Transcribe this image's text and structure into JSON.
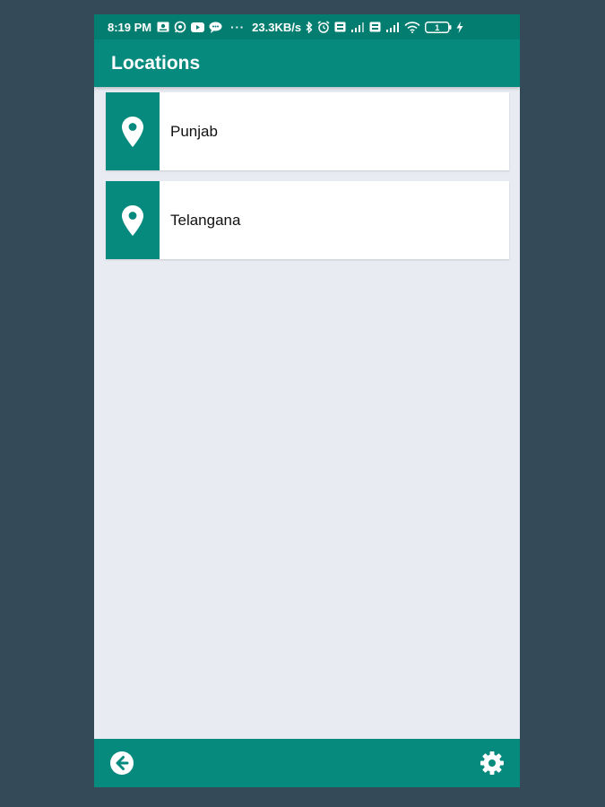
{
  "status_bar": {
    "time": "8:19 PM",
    "speed": "23.3KB/s",
    "dots": "···",
    "battery": "1",
    "icons": [
      "screenshot-icon",
      "whatsapp-icon",
      "youtube-icon",
      "chat-icon",
      "bluetooth-icon",
      "alarm-icon",
      "volte-icon",
      "signal-icon",
      "volte-icon",
      "signal-icon",
      "wifi-icon",
      "battery-icon",
      "charging-icon"
    ]
  },
  "app_bar": {
    "title": "Locations"
  },
  "locations": [
    {
      "name": "Punjab",
      "icon": "location-pin-icon"
    },
    {
      "name": "Telangana",
      "icon": "location-pin-icon"
    }
  ],
  "bottom_bar": {
    "back_icon": "arrow-left-circle-icon",
    "settings_icon": "gear-icon"
  },
  "colors": {
    "background": "#354a59",
    "status_bar": "#047d71",
    "primary": "#078a7e",
    "content_bg": "#e8ecf2",
    "card_bg": "#ffffff"
  }
}
